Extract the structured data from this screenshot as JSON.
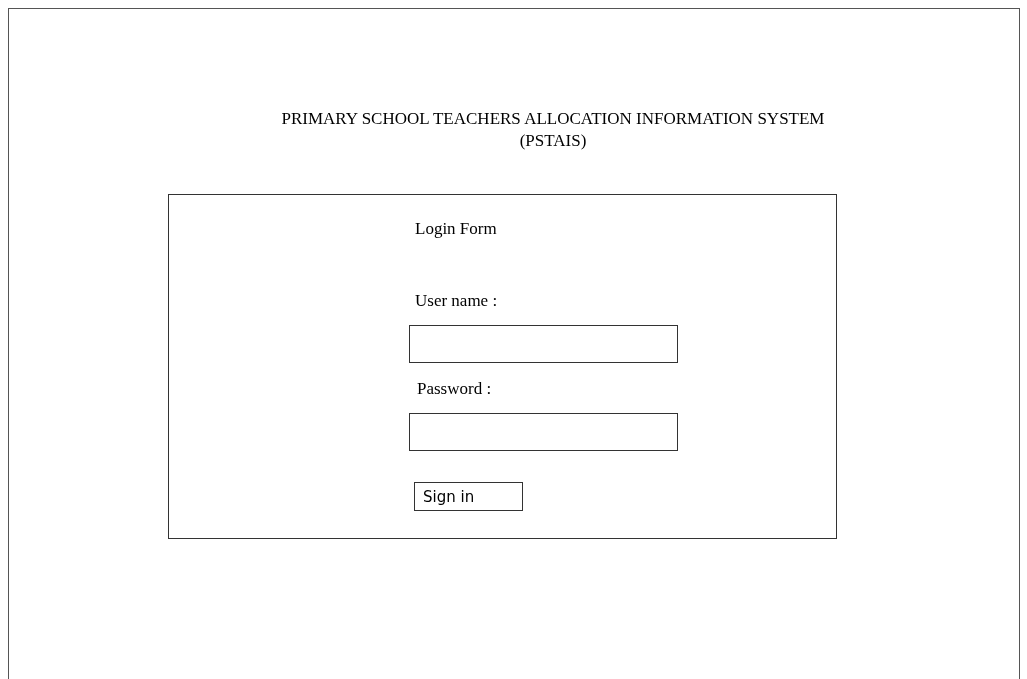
{
  "title": {
    "line_1": "PRIMARY SCHOOL TEACHERS ALLOCATION INFORMATION SYSTEM",
    "line_2": "(PSTAIS)"
  },
  "login_form": {
    "heading": "Login Form",
    "fields": [
      {
        "label": "User name :"
      },
      {
        "label": "Password :"
      }
    ],
    "button": "Sign in"
  }
}
